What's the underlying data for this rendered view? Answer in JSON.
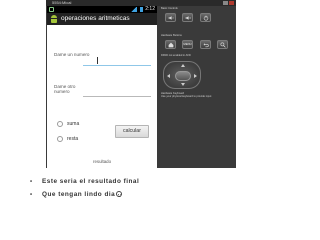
{
  "emulator": {
    "window_title": "5554:Mical"
  },
  "status_bar": {
    "time": "2:12"
  },
  "app": {
    "title": "operaciones aritmeticas"
  },
  "form": {
    "label_first_number": "Dame un numero",
    "label_second_number": "Dame otro numero",
    "first_number_value": "",
    "second_number_value": "",
    "radio_options": [
      {
        "label": "suma",
        "selected": false
      },
      {
        "label": "resta",
        "selected": false
      }
    ],
    "calculate_button": "calcular",
    "result_label": "resultado"
  },
  "controls": {
    "basic_controls_title": "Basic Controls",
    "hardware_buttons_title": "Hardware Buttons",
    "dpad_title": "DPAD not enabled in AVD",
    "keyboard_title": "Hardware Keyboard",
    "keyboard_hint": "Use your physical keyboard to provide input",
    "menu_label": "MENU",
    "icons": [
      "volume-down-icon",
      "volume-up-icon",
      "power-icon",
      "home-icon",
      "back-icon",
      "search-icon"
    ]
  },
  "notes": [
    {
      "text": "Este seria el resultado final"
    },
    {
      "text": "Que tengan lindo dia"
    }
  ],
  "colors": {
    "android_green": "#a4c639",
    "accent_blue": "#8fc7e8",
    "action_bar": "#222222",
    "status_bar": "#000000",
    "emulator_bg": "#3a3a3a"
  }
}
